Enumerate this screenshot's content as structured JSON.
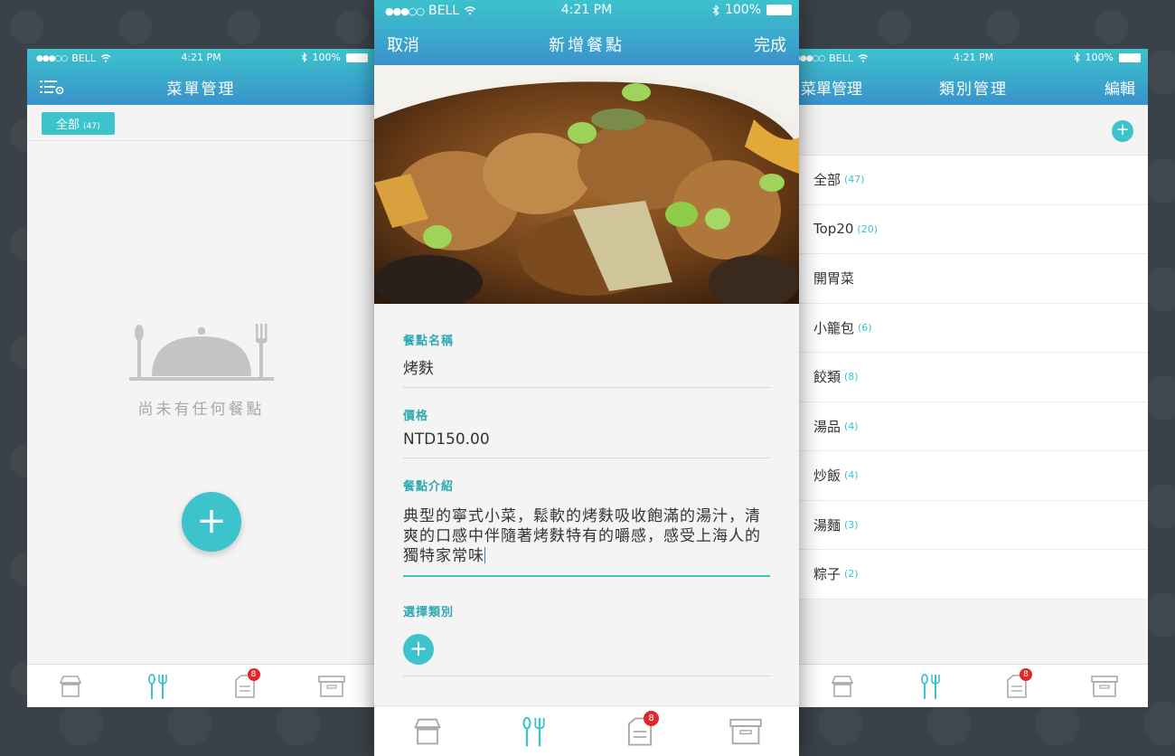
{
  "colors": {
    "accent": "#3cc3cc",
    "header_top": "#3cc3cc",
    "header_bottom": "#3a93cc",
    "badge": "#e02828"
  },
  "status": {
    "signal": "●●●○○",
    "carrier": "BELL",
    "time": "4:21 PM",
    "battery": "100%"
  },
  "left": {
    "title": "菜單管理",
    "menu_icon": "list-settings-icon",
    "filter": {
      "label": "全部",
      "count": "(47)"
    },
    "empty_text": "尚未有任何餐點",
    "add_label": "+"
  },
  "center": {
    "cancel": "取消",
    "title": "新增餐點",
    "done": "完成",
    "name_label": "餐點名稱",
    "name_value": "烤麩",
    "price_label": "價格",
    "price_value": "NTD150.00",
    "desc_label": "餐點介紹",
    "desc_value": "典型的寧式小菜，鬆軟的烤麩吸收飽滿的湯汁，清爽的口感中伴隨著烤麩特有的嚼感，感受上海人的獨特家常味",
    "category_label": "選擇類別",
    "add_label": "+"
  },
  "right": {
    "back": "菜單管理",
    "title": "類別管理",
    "edit": "編輯",
    "add_label": "+",
    "categories": [
      {
        "name": "全部",
        "count": "(47)"
      },
      {
        "name": "Top20",
        "count": "(20)"
      },
      {
        "name": "開胃菜",
        "count": ""
      },
      {
        "name": "小籠包",
        "count": "(6)"
      },
      {
        "name": "餃類",
        "count": "(8)"
      },
      {
        "name": "湯品",
        "count": "(4)"
      },
      {
        "name": "炒飯",
        "count": "(4)"
      },
      {
        "name": "湯麵",
        "count": "(3)"
      },
      {
        "name": "粽子",
        "count": "(2)"
      }
    ]
  },
  "tabbar": {
    "tabs": [
      {
        "icon": "store-icon",
        "active": false
      },
      {
        "icon": "cutlery-icon",
        "active": true
      },
      {
        "icon": "orders-icon",
        "active": false,
        "badge": "8"
      },
      {
        "icon": "archive-icon",
        "active": false
      }
    ]
  }
}
